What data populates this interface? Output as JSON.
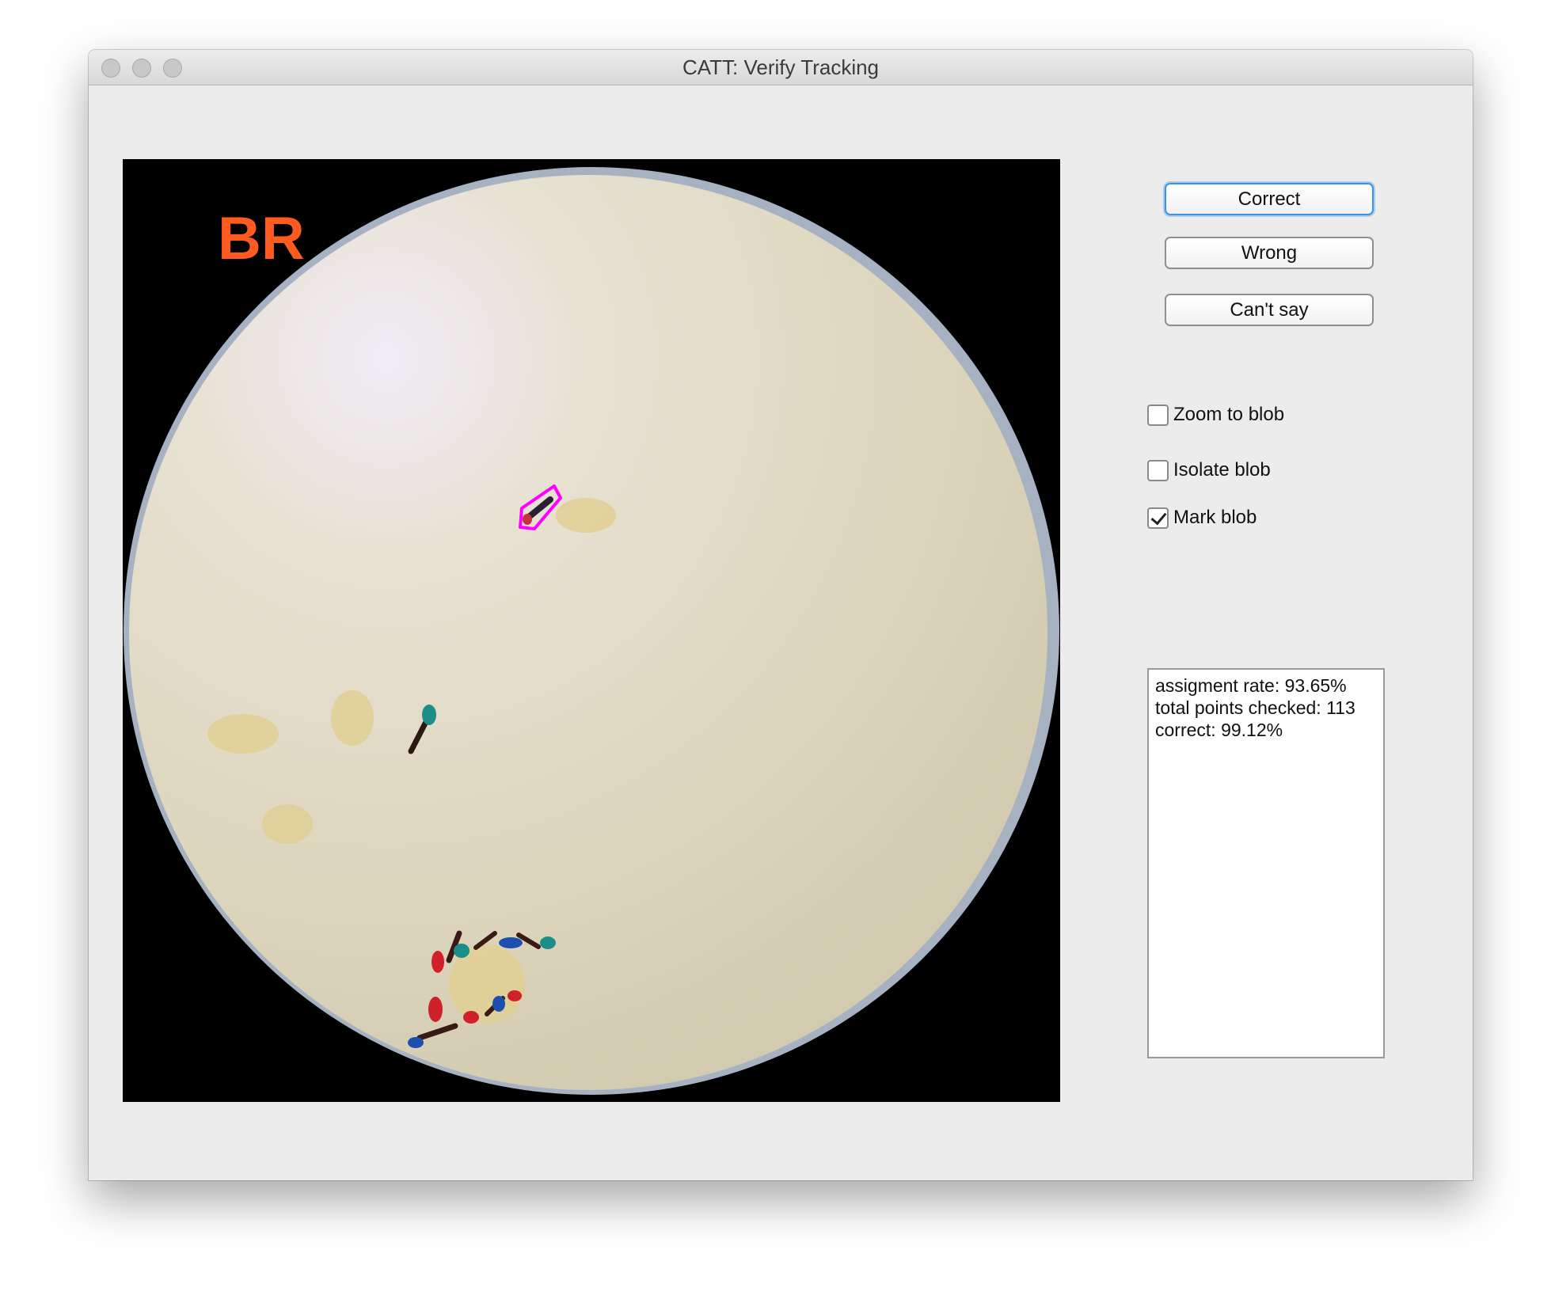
{
  "window": {
    "title": "CATT: Verify Tracking"
  },
  "image": {
    "overlay_label": "BR",
    "overlay_color": "#ff5a1f",
    "marker_color": "#ff00ff"
  },
  "buttons": {
    "correct": "Correct",
    "wrong": "Wrong",
    "cant_say": "Can't say"
  },
  "options": [
    {
      "label": "Zoom to blob",
      "checked": false
    },
    {
      "label": "Isolate blob",
      "checked": false
    },
    {
      "label": "Mark blob",
      "checked": true
    }
  ],
  "stats": {
    "line1": "assigment rate: 93.65%",
    "line2": "total points checked: 113",
    "line3": "correct: 99.12%"
  }
}
